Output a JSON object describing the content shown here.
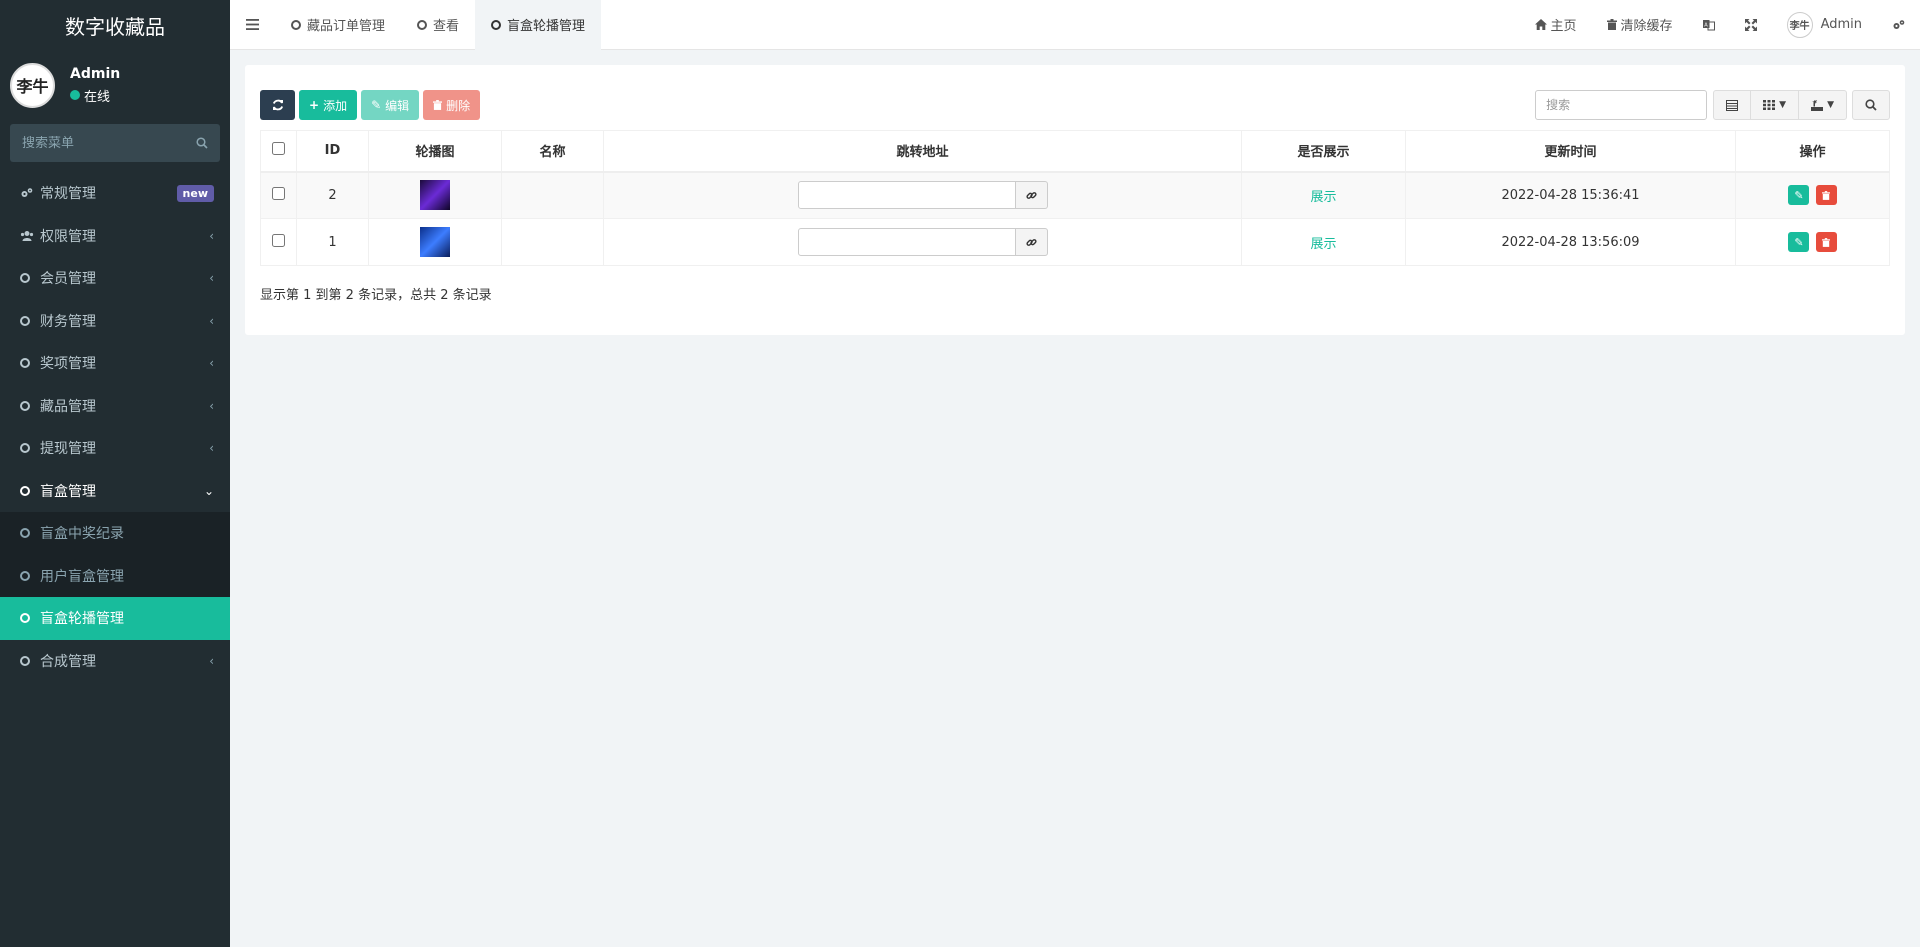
{
  "sidebar": {
    "brand": "数字收藏品",
    "avatar_text": "李牛",
    "user_name": "Admin",
    "user_status": "在线",
    "search_placeholder": "搜索菜单",
    "items": [
      {
        "label": "常规管理",
        "badge": "new"
      },
      {
        "label": "权限管理"
      },
      {
        "label": "会员管理"
      },
      {
        "label": "财务管理"
      },
      {
        "label": "奖项管理"
      },
      {
        "label": "藏品管理"
      },
      {
        "label": "提现管理"
      },
      {
        "label": "盲盒管理"
      },
      {
        "label": "盲盒中奖纪录"
      },
      {
        "label": "用户盲盒管理"
      },
      {
        "label": "盲盒轮播管理"
      },
      {
        "label": "合成管理"
      }
    ]
  },
  "topbar": {
    "tabs": [
      "藏品订单管理",
      "查看",
      "盲盒轮播管理"
    ],
    "home": "主页",
    "clear_cache": "清除缓存",
    "admin": "Admin",
    "avatar_text": "李牛"
  },
  "toolbar": {
    "add": "添加",
    "edit": "编辑",
    "delete": "删除",
    "search_placeholder": "搜索"
  },
  "table": {
    "headers": [
      "ID",
      "轮播图",
      "名称",
      "跳转地址",
      "是否展示",
      "更新时间",
      "操作"
    ],
    "rows": [
      {
        "id": "2",
        "name": "",
        "url": "",
        "show": "展示",
        "updated": "2022-04-28 15:36:41"
      },
      {
        "id": "1",
        "name": "",
        "url": "",
        "show": "展示",
        "updated": "2022-04-28 13:56:09"
      }
    ]
  },
  "footer": {
    "summary": "显示第 1 到第 2 条记录，总共 2 条记录"
  },
  "colors": {
    "accent": "#18bc9c",
    "sidebar_bg": "#222d32",
    "danger": "#e74c3c",
    "dark": "#2c3e50"
  }
}
